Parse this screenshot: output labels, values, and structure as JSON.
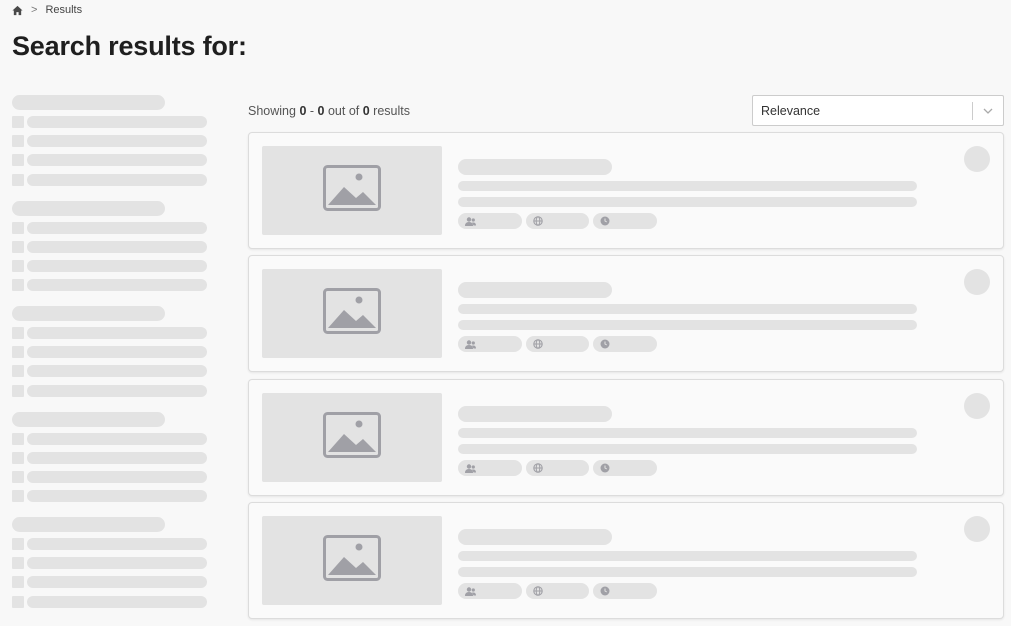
{
  "breadcrumb": {
    "home_icon": "home-icon",
    "separator": ">",
    "current": "Results"
  },
  "page_title": "Search results for:",
  "results_summary": {
    "prefix": "Showing",
    "from": "0",
    "dash": "-",
    "to": "0",
    "middle": "out of",
    "total": "0",
    "suffix": "results"
  },
  "sort": {
    "selected": "Relevance",
    "icon": "chevron-down-icon"
  },
  "colors": {
    "skeleton": "#e3e3e3",
    "icon_gray": "#a0a0a6",
    "background": "#f8f8f8"
  },
  "skeleton_icons": [
    "image-icon",
    "users-icon",
    "globe-icon",
    "clock-icon"
  ]
}
